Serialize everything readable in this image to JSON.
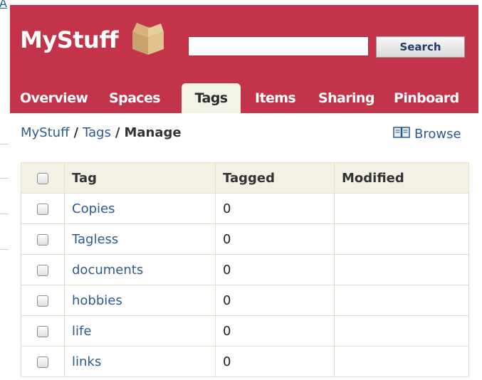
{
  "edge": {
    "corner_letter": "A"
  },
  "header": {
    "logo": "MyStuff",
    "search": {
      "value": "",
      "placeholder": "",
      "button_label": "Search"
    },
    "tabs": [
      {
        "label": "Overview",
        "active": false
      },
      {
        "label": "Spaces",
        "active": false
      },
      {
        "label": "Tags",
        "active": true
      },
      {
        "label": "Items",
        "active": false
      },
      {
        "label": "Sharing",
        "active": false
      },
      {
        "label": "Pinboard",
        "active": false
      }
    ]
  },
  "breadcrumb": {
    "root": "MyStuff",
    "section": "Tags",
    "current": "Manage"
  },
  "browse_label": "Browse",
  "table": {
    "columns": [
      "Tag",
      "Tagged",
      "Modified"
    ],
    "rows": [
      {
        "tag": "Copies",
        "tagged": "0",
        "modified": ""
      },
      {
        "tag": "Tagless",
        "tagged": "0",
        "modified": ""
      },
      {
        "tag": "documents",
        "tagged": "0",
        "modified": ""
      },
      {
        "tag": "hobbies",
        "tagged": "0",
        "modified": ""
      },
      {
        "tag": "life",
        "tagged": "0",
        "modified": ""
      },
      {
        "tag": "links",
        "tagged": "0",
        "modified": ""
      }
    ]
  },
  "colors": {
    "header_bg": "#c3334a",
    "active_tab_bg": "#f4f3e8",
    "link": "#2d5a8e",
    "table_header_bg": "#f3f1e3"
  }
}
